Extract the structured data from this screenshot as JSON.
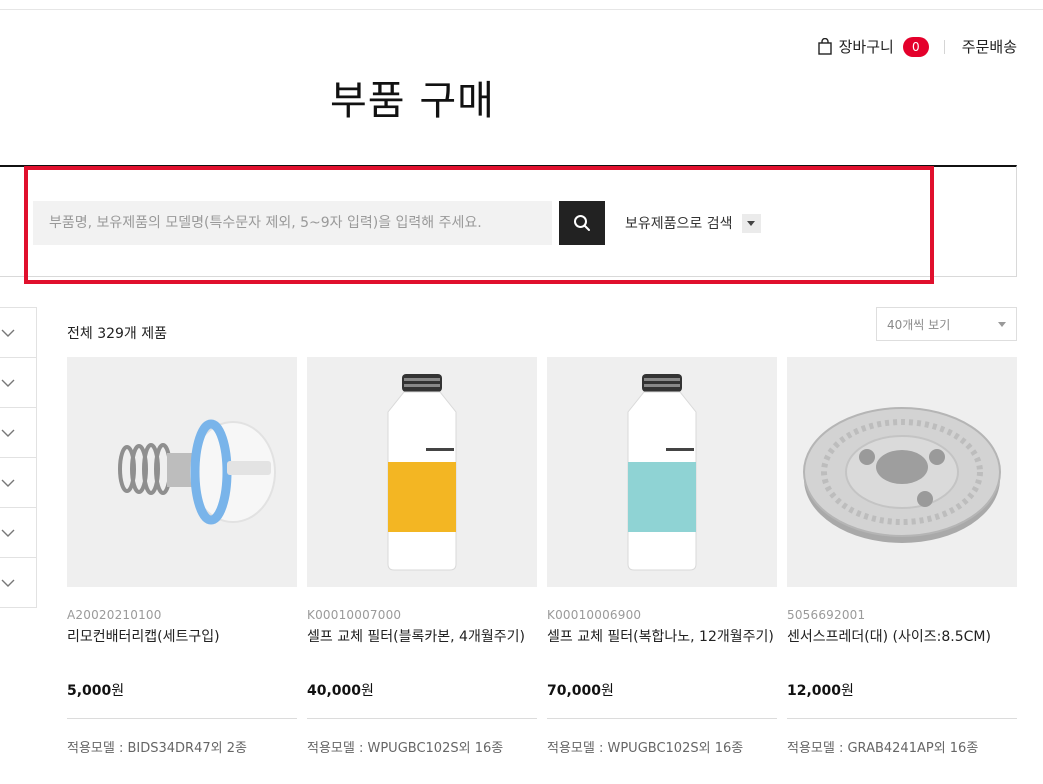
{
  "header": {
    "cart_label": "장바구니",
    "cart_count": "0",
    "orders_label": "주문배송",
    "page_title": "부품 구매"
  },
  "search": {
    "placeholder": "부품명, 보유제품의 모델명(특수문자 제외, 5~9자 입력)을 입력해 주세요.",
    "value": "",
    "option_label": "보유제품으로 검색"
  },
  "listing": {
    "total": "전체 329개 제품",
    "sort_selected": "40개씩 보기"
  },
  "products": [
    {
      "code": "A20020210100",
      "name": "리모컨배터리캡(세트구입)",
      "price": "5,000",
      "unit": "원",
      "models": "적용모델 : BIDS34DR47외 2종"
    },
    {
      "code": "K00010007000",
      "name": "셀프 교체 필터(블록카본, 4개월주기)",
      "price": "40,000",
      "unit": "원",
      "models": "적용모델 : WPUGBC102S외 16종"
    },
    {
      "code": "K00010006900",
      "name": "셀프 교체 필터(복합나노, 12개월주기)",
      "price": "70,000",
      "unit": "원",
      "models": "적용모델 : WPUGBC102S외 16종"
    },
    {
      "code": "5056692001",
      "name": "센서스프레더(대) (사이즈:8.5CM)",
      "price": "12,000",
      "unit": "원",
      "models": "적용모델 : GRAB4241AP외 16종"
    }
  ],
  "colors": {
    "accent": "#e4002b",
    "highlight": "#e0102d",
    "dark": "#222222"
  },
  "icons": {
    "cart": "shopping-bag-icon",
    "search": "magnifier-icon",
    "filter": "chevron-down-icon"
  }
}
